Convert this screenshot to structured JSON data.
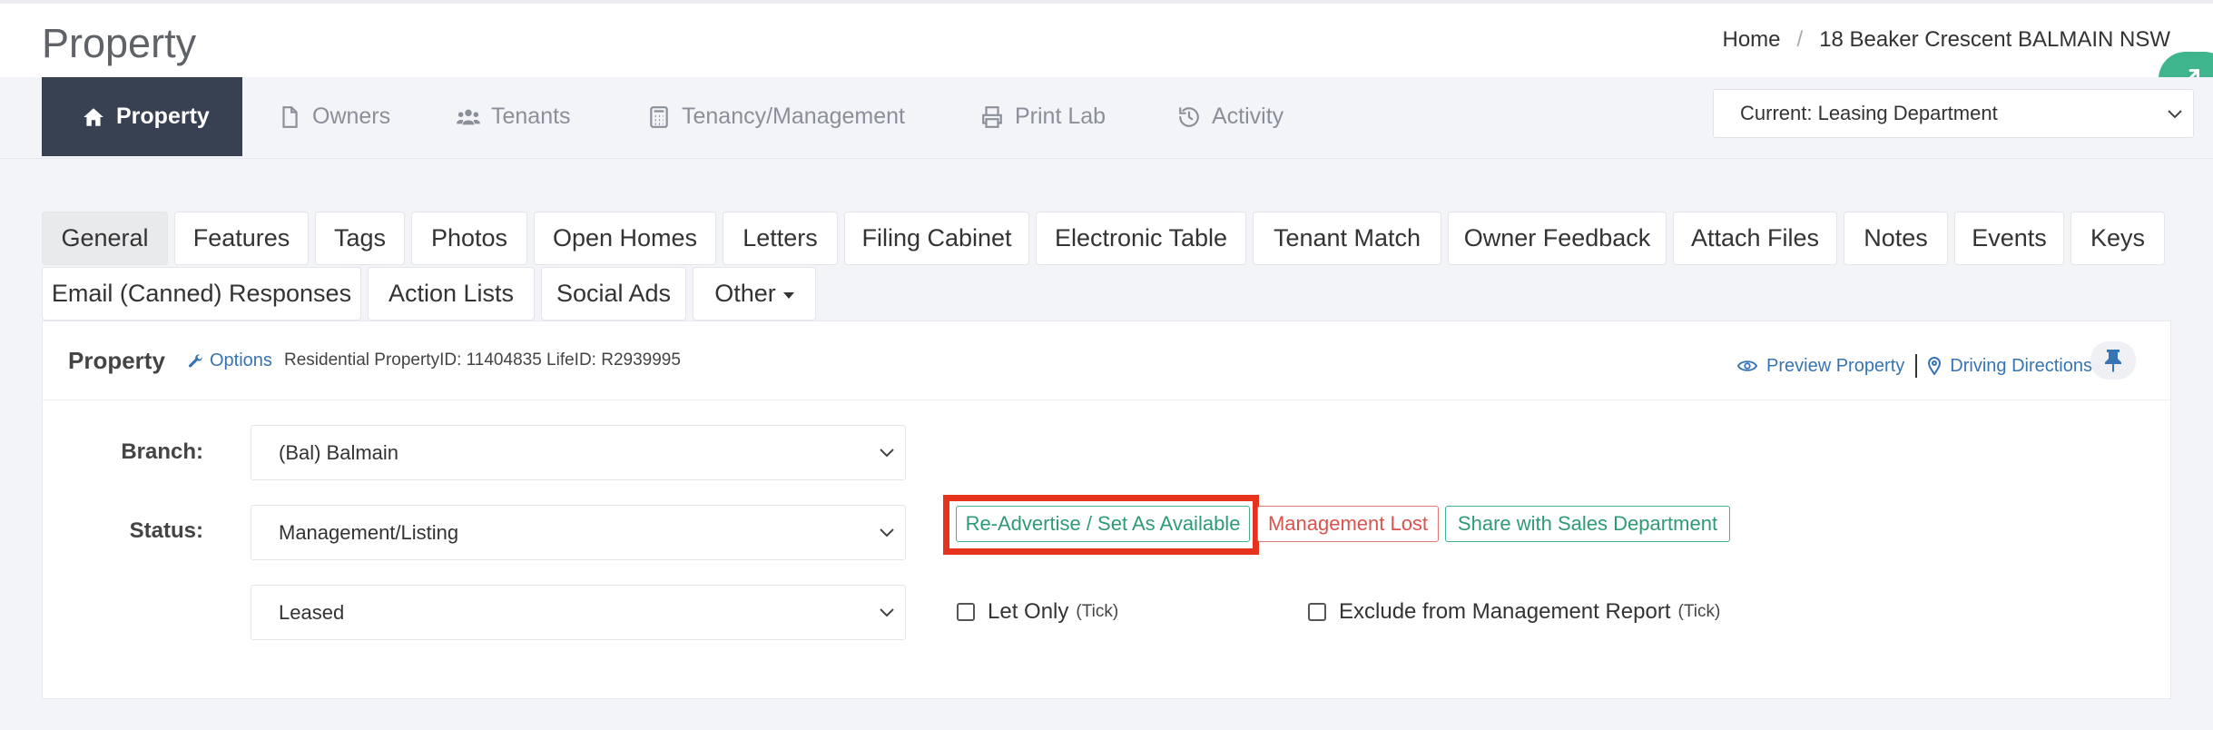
{
  "header": {
    "page_title": "Property",
    "breadcrumb": {
      "home": "Home",
      "separator": "/",
      "current": "18 Beaker Crescent BALMAIN NSW"
    }
  },
  "nav": {
    "tabs": [
      {
        "label": "Property",
        "icon": "home-icon",
        "active": true
      },
      {
        "label": "Owners",
        "icon": "file-icon"
      },
      {
        "label": "Tenants",
        "icon": "users-icon"
      },
      {
        "label": "Tenancy/Management",
        "icon": "calculator-icon"
      },
      {
        "label": "Print Lab",
        "icon": "print-icon"
      },
      {
        "label": "Activity",
        "icon": "history-icon"
      }
    ],
    "department_select": "Current: Leasing Department"
  },
  "subtabs": {
    "row1": [
      "General",
      "Features",
      "Tags",
      "Photos",
      "Open Homes",
      "Letters",
      "Filing Cabinet",
      "Electronic Table",
      "Tenant Match",
      "Owner Feedback",
      "Attach Files",
      "Notes",
      "Events",
      "Keys"
    ],
    "row2": [
      "Email (Canned) Responses",
      "Action Lists",
      "Social Ads",
      "Other"
    ],
    "active": "General"
  },
  "panel": {
    "title": "Property",
    "options_label": "Options",
    "meta": "Residential PropertyID: 11404835 LifeID: R2939995",
    "preview_label": "Preview Property",
    "directions_label": "Driving Directions"
  },
  "form": {
    "branch_label": "Branch:",
    "branch_value": "(Bal) Balmain",
    "status_label": "Status:",
    "status_value": "Management/Listing",
    "substatus_value": "Leased",
    "readvertise_label": "Re-Advertise / Set As Available",
    "management_lost_label": "Management Lost",
    "share_sales_label": "Share with Sales Department",
    "let_only_label": "Let Only",
    "let_only_hint": "(Tick)",
    "exclude_label": "Exclude from Management Report",
    "exclude_hint": "(Tick)"
  },
  "colors": {
    "nav_active_bg": "#384152",
    "green_accent": "#3fb58e",
    "link_blue": "#3774b3",
    "danger_red": "#d9534f",
    "highlight_red": "#e5331e"
  }
}
